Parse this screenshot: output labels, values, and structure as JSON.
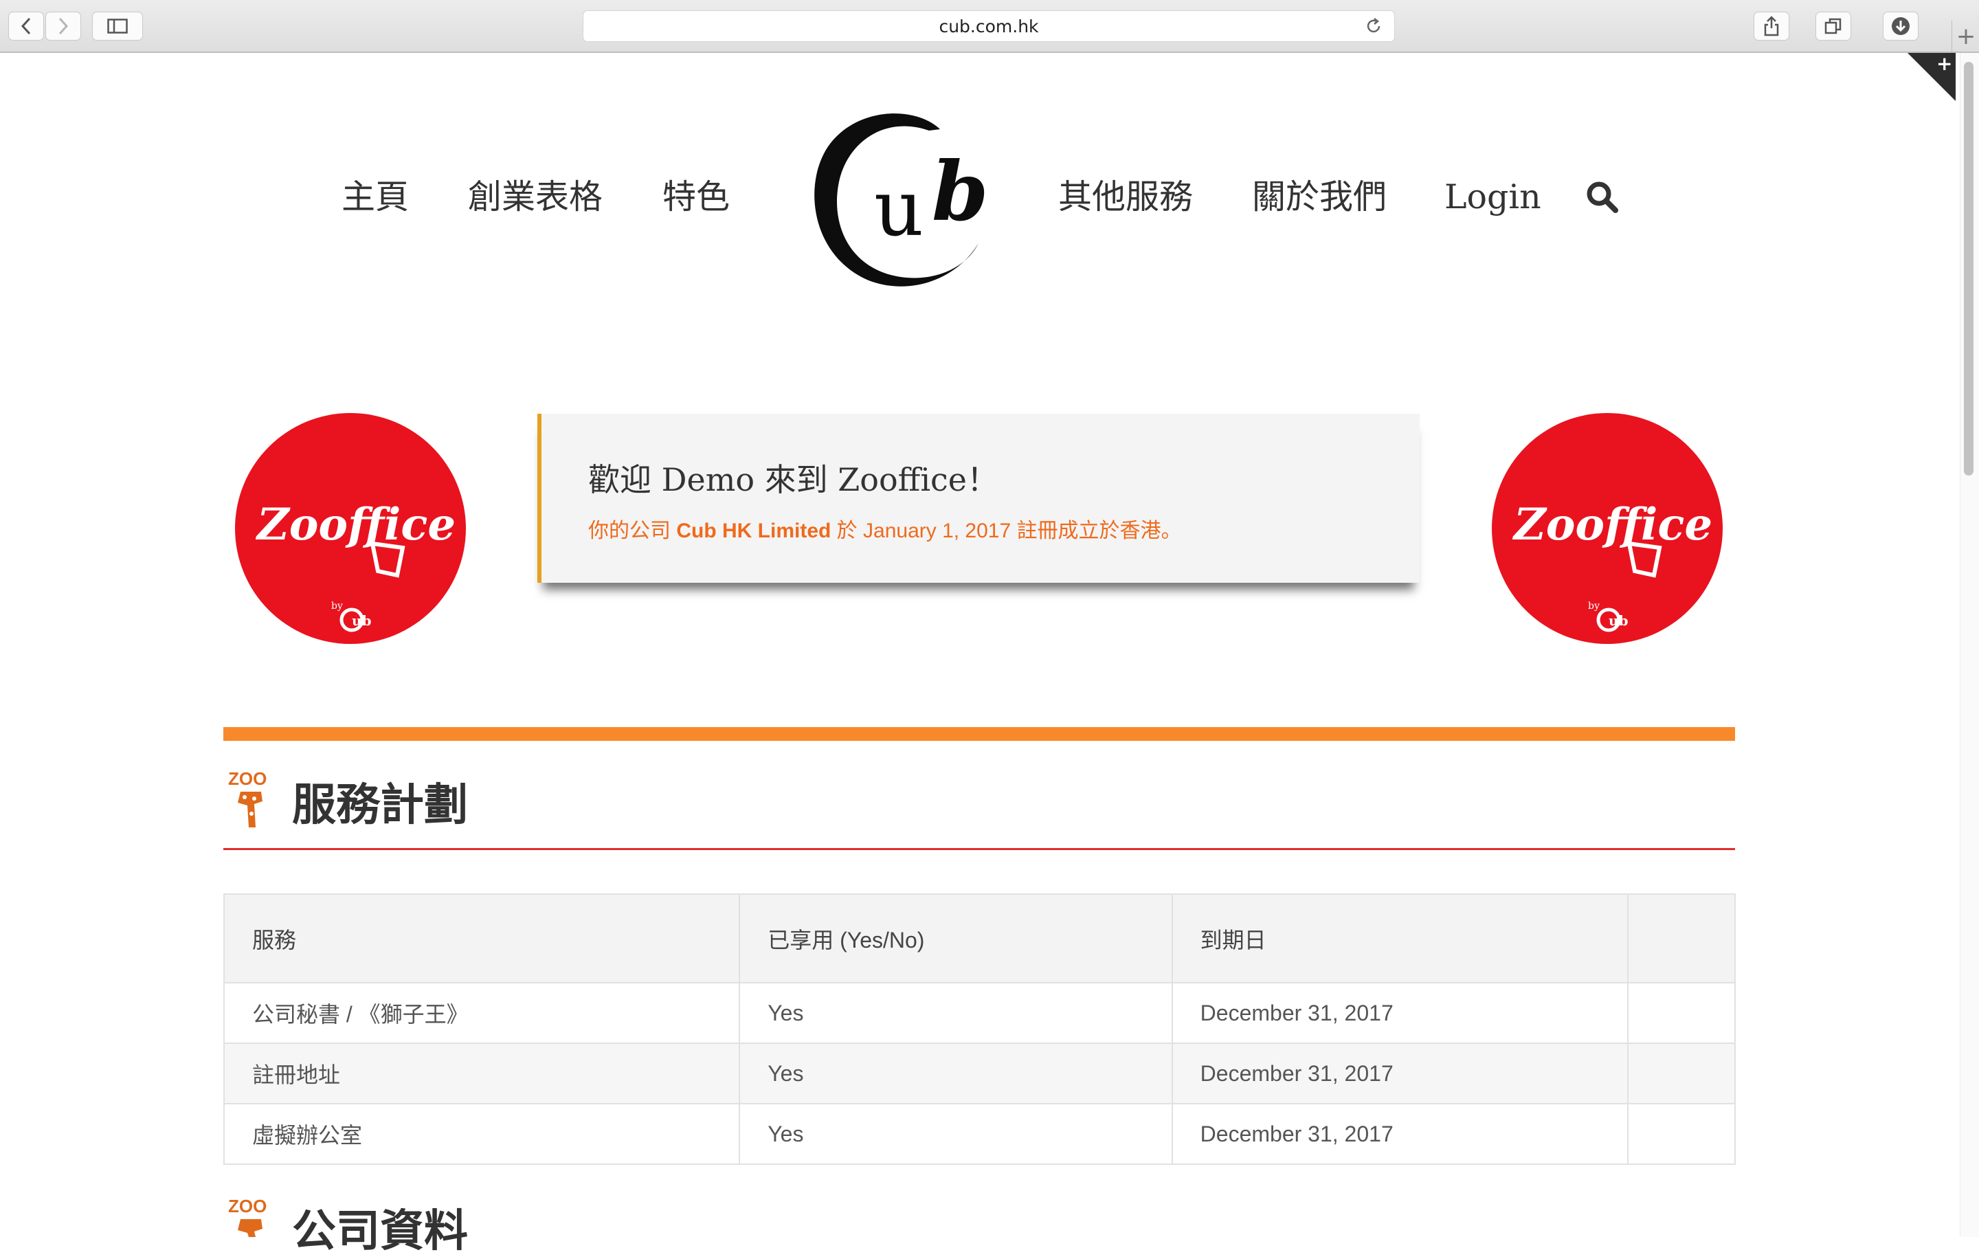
{
  "browser": {
    "url": "cub.com.hk",
    "icons": [
      "back-icon",
      "forward-icon",
      "sidebar-icon",
      "reload-icon",
      "share-icon",
      "tabs-icon",
      "downloads-icon",
      "new-tab-icon"
    ]
  },
  "nav": {
    "left": [
      "主頁",
      "創業表格",
      "特色"
    ],
    "right": [
      "其他服務",
      "關於我們",
      "Login"
    ],
    "logo_text": "Cub"
  },
  "hero": {
    "badge_text": "Zooffice",
    "badge_by": "by",
    "welcome_title": "歡迎 Demo 來到 Zooffice！",
    "welcome_sub_prefix": "你的公司 ",
    "welcome_sub_company": "Cub HK Limited",
    "welcome_sub_suffix": " 於 January 1, 2017 註冊成立於香港。"
  },
  "services_section": {
    "zoo_label": "ZOO",
    "title": "服務計劃",
    "columns": [
      "服務",
      "已享用 (Yes/No)",
      "到期日",
      ""
    ],
    "rows": [
      [
        "公司秘書 / 《獅子王》",
        "Yes",
        "December 31, 2017",
        ""
      ],
      [
        "註冊地址",
        "Yes",
        "December 31, 2017",
        ""
      ],
      [
        "虛擬辦公室",
        "Yes",
        "December 31, 2017",
        ""
      ]
    ]
  },
  "company_section": {
    "zoo_label": "ZOO",
    "title": "公司資料"
  },
  "colors": {
    "accent_orange": "#f7892a",
    "rule_red": "#e02d2d",
    "badge_red": "#e8131f",
    "welcome_text_orange": "#ef6a1c"
  }
}
